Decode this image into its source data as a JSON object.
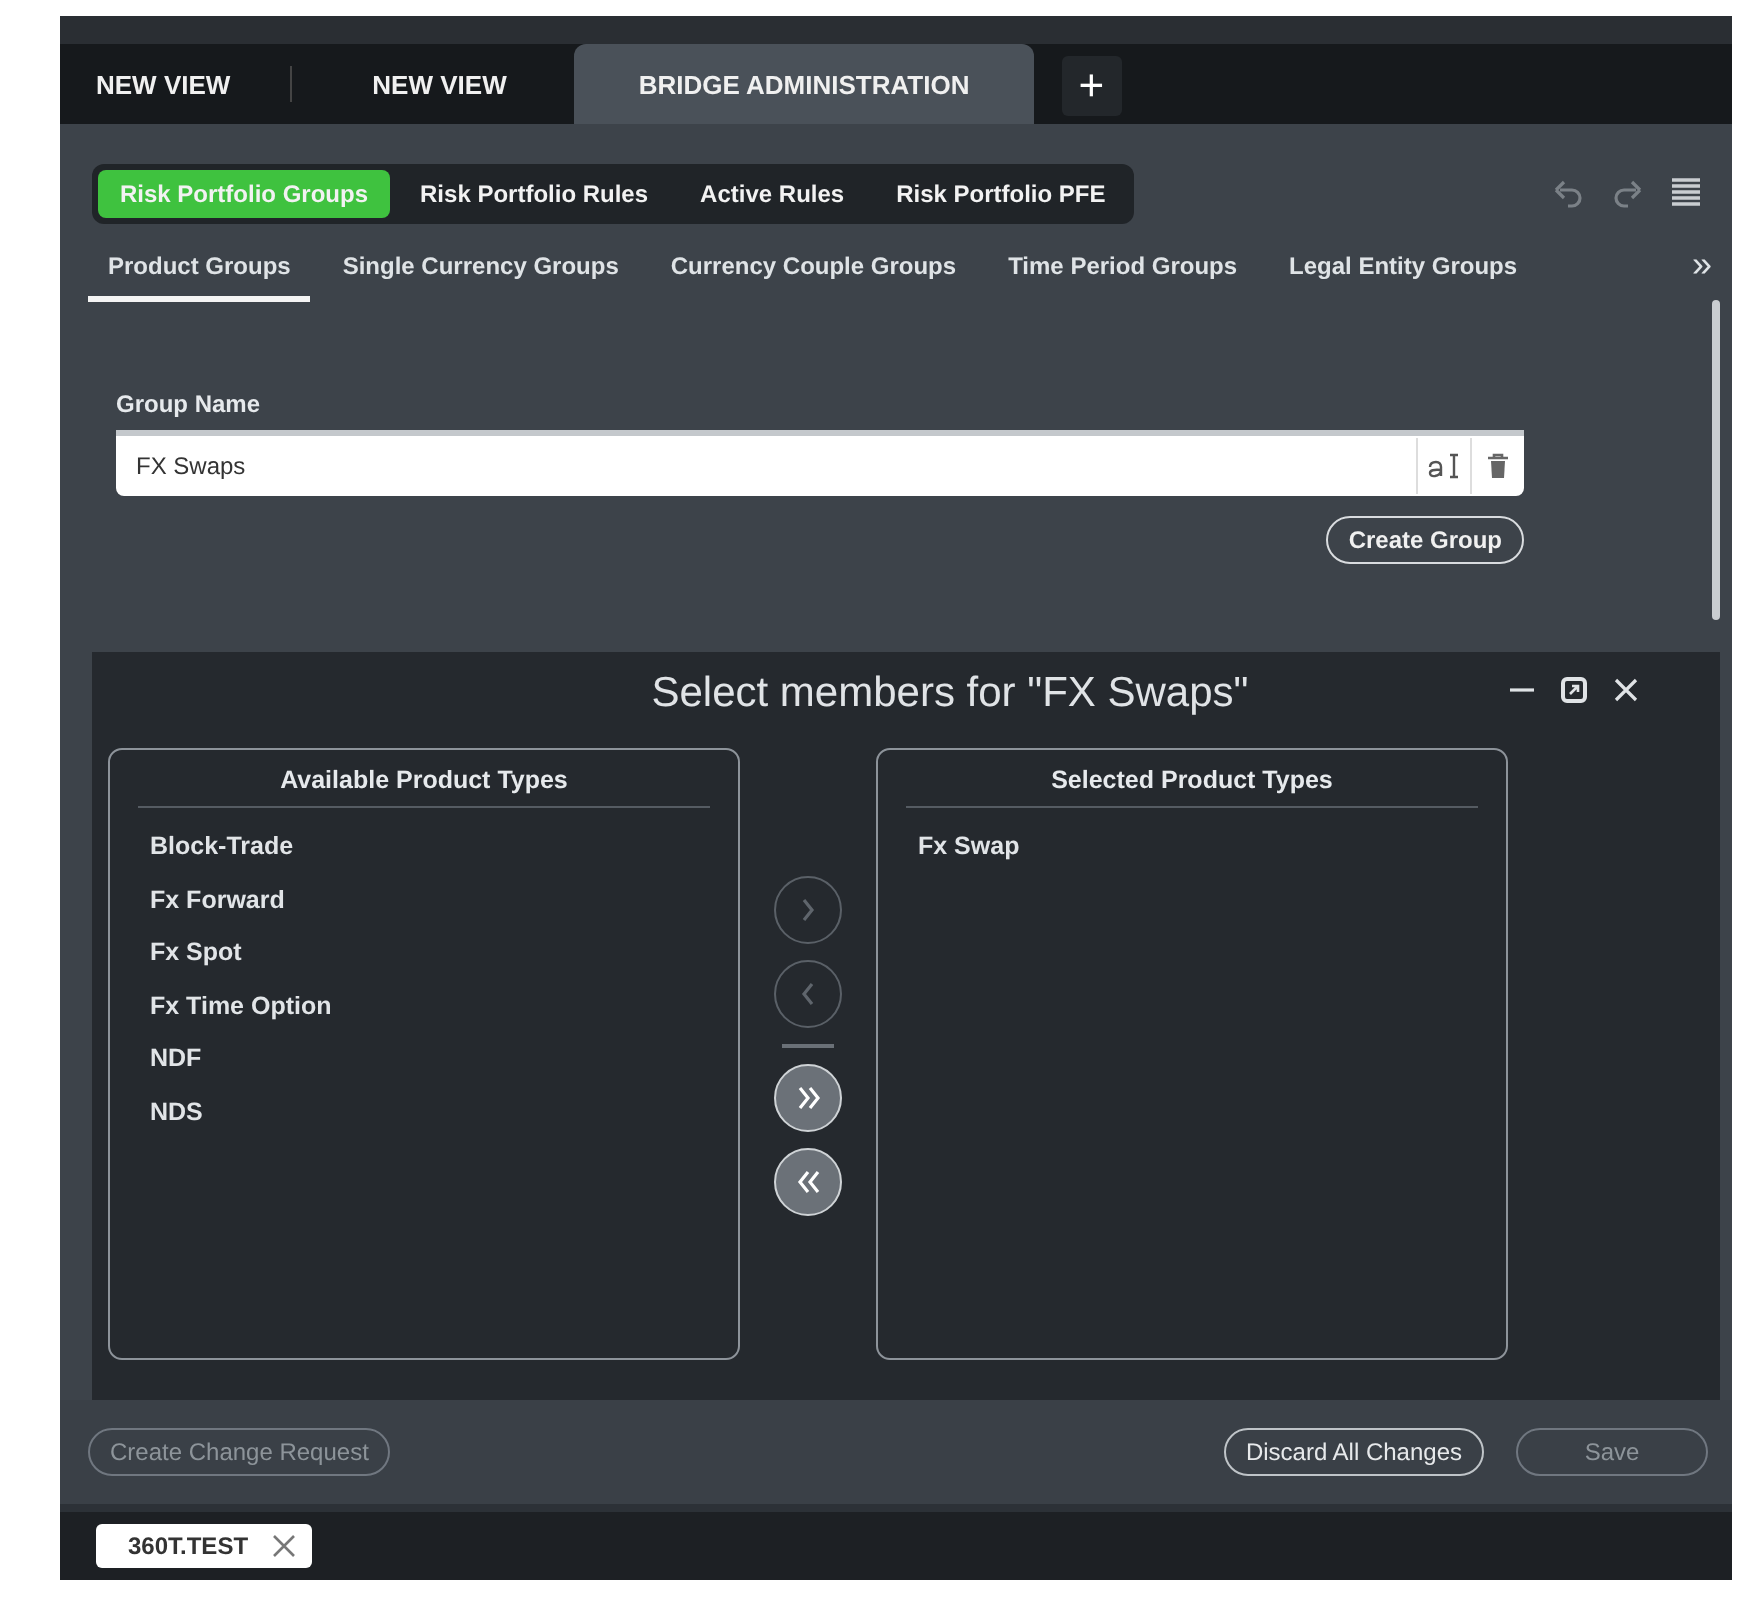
{
  "view_tabs": [
    {
      "label": "NEW VIEW",
      "selected": false
    },
    {
      "label": "NEW VIEW",
      "selected": false
    },
    {
      "label": "BRIDGE ADMINISTRATION",
      "selected": true
    }
  ],
  "add_tab": "+",
  "sections": [
    {
      "label": "Risk Portfolio Groups",
      "selected": true
    },
    {
      "label": "Risk Portfolio Rules",
      "selected": false
    },
    {
      "label": "Active Rules",
      "selected": false
    },
    {
      "label": "Risk Portfolio PFE",
      "selected": false
    }
  ],
  "group_tabs": [
    {
      "label": "Product Groups",
      "selected": true
    },
    {
      "label": "Single Currency Groups",
      "selected": false
    },
    {
      "label": "Currency Couple Groups",
      "selected": false
    },
    {
      "label": "Time Period Groups",
      "selected": false
    },
    {
      "label": "Legal Entity Groups",
      "selected": false
    }
  ],
  "more_tabs": "»",
  "group_form": {
    "label": "Group Name",
    "value": "FX Swaps",
    "button": "Create Group"
  },
  "dialog": {
    "title": "Select members for \"FX Swaps\"",
    "available": {
      "title": "Available Product Types",
      "items": [
        "Block-Trade",
        "Fx Forward",
        "Fx Spot",
        "Fx Time Option",
        "NDF",
        "NDS"
      ]
    },
    "selected": {
      "title": "Selected Product Types",
      "items": [
        "Fx Swap"
      ]
    },
    "transfer_buttons": [
      {
        "kind": "add",
        "disabled": true
      },
      {
        "kind": "remove",
        "disabled": true
      },
      {
        "kind": "add_all",
        "disabled": false
      },
      {
        "kind": "remove_all",
        "disabled": false
      }
    ]
  },
  "footer_buttons": [
    {
      "label": "Create Change Request",
      "disabled": true
    },
    {
      "label": "Discard All Changes",
      "disabled": false
    },
    {
      "label": "Save",
      "disabled": true
    }
  ],
  "session_tag": {
    "label": "360T.TEST"
  }
}
